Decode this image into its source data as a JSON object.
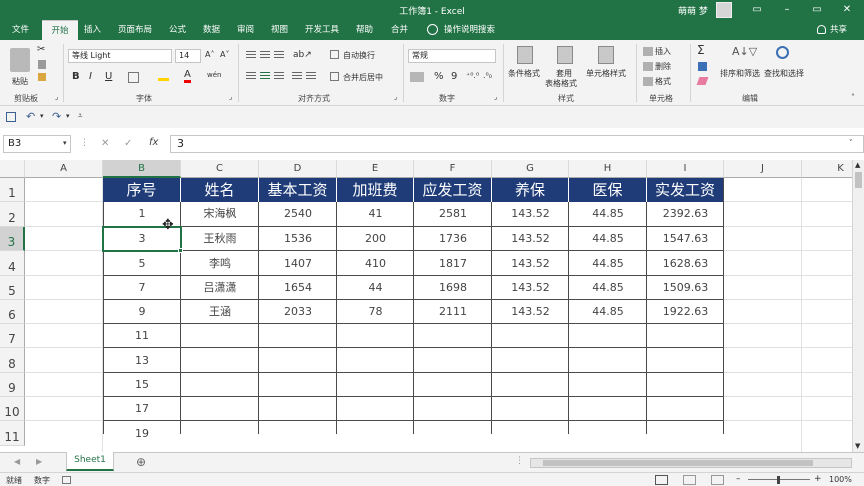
{
  "window": {
    "title": "工作簿1 - Excel",
    "user": "萌萌 梦",
    "minimize": "–",
    "restore": "▭",
    "close": "✕"
  },
  "tabs": [
    "文件",
    "开始",
    "插入",
    "页面布局",
    "公式",
    "数据",
    "审阅",
    "视图",
    "开发工具",
    "帮助",
    "合并"
  ],
  "active_tab": "开始",
  "tell_me": "操作说明搜索",
  "share": "共享",
  "ribbon": {
    "clipboard": {
      "label": "剪贴板",
      "paste": "粘贴"
    },
    "font": {
      "label": "字体",
      "name": "等线 Light",
      "size": "14",
      "bold": "B",
      "italic": "I",
      "underline": "U",
      "grow": "A˄",
      "shrink": "A˅",
      "color_a": "A",
      "wen": "wén"
    },
    "alignment": {
      "label": "对齐方式",
      "wrap": "自动换行",
      "merge": "合并后居中"
    },
    "number": {
      "label": "数字",
      "format": "常规",
      "percent": "%",
      "comma": "9",
      "dec_inc": "⁺⁰.⁰",
      "dec_dec": ".⁰₀"
    },
    "styles": {
      "label": "样式",
      "conditional": "条件格式",
      "table1": "套用",
      "table2": "表格格式",
      "cell": "单元格样式"
    },
    "cells": {
      "label": "单元格",
      "insert": "插入",
      "delete": "删除",
      "format": "格式"
    },
    "editing": {
      "label": "编辑",
      "sort": "排序和筛选",
      "find": "查找和选择"
    }
  },
  "formula_bar": {
    "name_box": "B3",
    "cancel": "✕",
    "enter": "✓",
    "fx": "fx",
    "value": "3"
  },
  "columns": [
    "A",
    "B",
    "C",
    "D",
    "E",
    "F",
    "G",
    "H",
    "I",
    "J",
    "K"
  ],
  "rows": [
    "1",
    "2",
    "3",
    "4",
    "5",
    "6",
    "7",
    "8",
    "9",
    "10",
    "11"
  ],
  "table": {
    "headers": [
      "序号",
      "姓名",
      "基本工资",
      "加班费",
      "应发工资",
      "养保",
      "医保",
      "实发工资"
    ],
    "rows": [
      [
        "1",
        "宋海枫",
        "2540",
        "41",
        "2581",
        "143.52",
        "44.85",
        "2392.63"
      ],
      [
        "3",
        "王秋雨",
        "1536",
        "200",
        "1736",
        "143.52",
        "44.85",
        "1547.63"
      ],
      [
        "5",
        "李鸣",
        "1407",
        "410",
        "1817",
        "143.52",
        "44.85",
        "1628.63"
      ],
      [
        "7",
        "吕潇潇",
        "1654",
        "44",
        "1698",
        "143.52",
        "44.85",
        "1509.63"
      ],
      [
        "9",
        "王涵",
        "2033",
        "78",
        "2111",
        "143.52",
        "44.85",
        "1922.63"
      ],
      [
        "11",
        "",
        "",
        "",
        "",
        "",
        "",
        ""
      ],
      [
        "13",
        "",
        "",
        "",
        "",
        "",
        "",
        ""
      ],
      [
        "15",
        "",
        "",
        "",
        "",
        "",
        "",
        ""
      ],
      [
        "17",
        "",
        "",
        "",
        "",
        "",
        "",
        ""
      ],
      [
        "19",
        "",
        "",
        "",
        "",
        "",
        "",
        ""
      ]
    ]
  },
  "sheets": [
    "Sheet1"
  ],
  "add_sheet": "⊕",
  "status": {
    "ready": "就绪",
    "mode": "数字",
    "zoom": "100%",
    "zoom_minus": "–",
    "zoom_plus": "+"
  }
}
